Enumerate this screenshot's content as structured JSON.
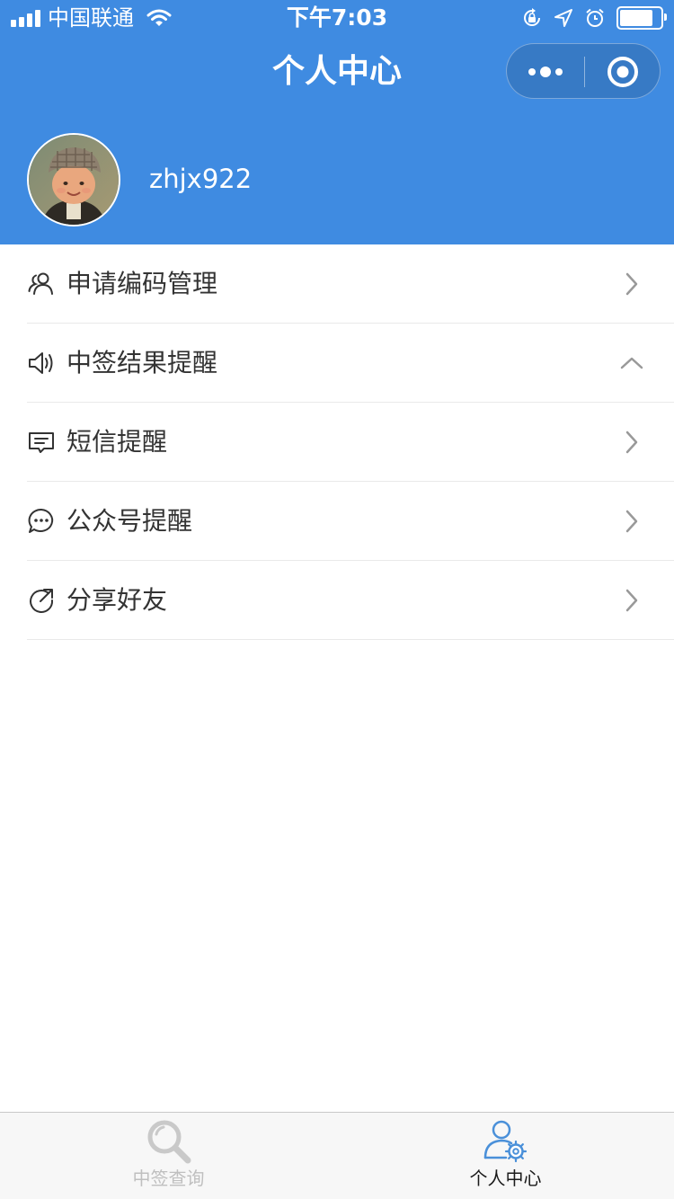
{
  "status_bar": {
    "carrier": "中国联通",
    "time": "下午7:03"
  },
  "nav": {
    "title": "个人中心",
    "more_icon": "more-dots-icon",
    "close_icon": "target-circle-icon"
  },
  "profile": {
    "username": "zhjx922",
    "avatar_icon": "avatar-photo"
  },
  "menu": {
    "items": [
      {
        "label": "申请编码管理",
        "icon": "users-icon",
        "arrow": "chevron-right"
      },
      {
        "label": "中签结果提醒",
        "icon": "speaker-icon",
        "arrow": "chevron-up"
      },
      {
        "label": "短信提醒",
        "icon": "message-box-icon",
        "arrow": "chevron-right"
      },
      {
        "label": "公众号提醒",
        "icon": "chat-bubble-icon",
        "arrow": "chevron-right"
      },
      {
        "label": "分享好友",
        "icon": "share-icon",
        "arrow": "chevron-right"
      }
    ]
  },
  "tabbar": {
    "tabs": [
      {
        "label": "中签查询",
        "icon": "search-icon",
        "active": false
      },
      {
        "label": "个人中心",
        "icon": "user-settings-icon",
        "active": true
      }
    ]
  },
  "colors": {
    "primary": "#3f8be1",
    "tab_active_icon": "#4a90d9",
    "tab_inactive": "#bfbfbf",
    "text": "#333333"
  }
}
